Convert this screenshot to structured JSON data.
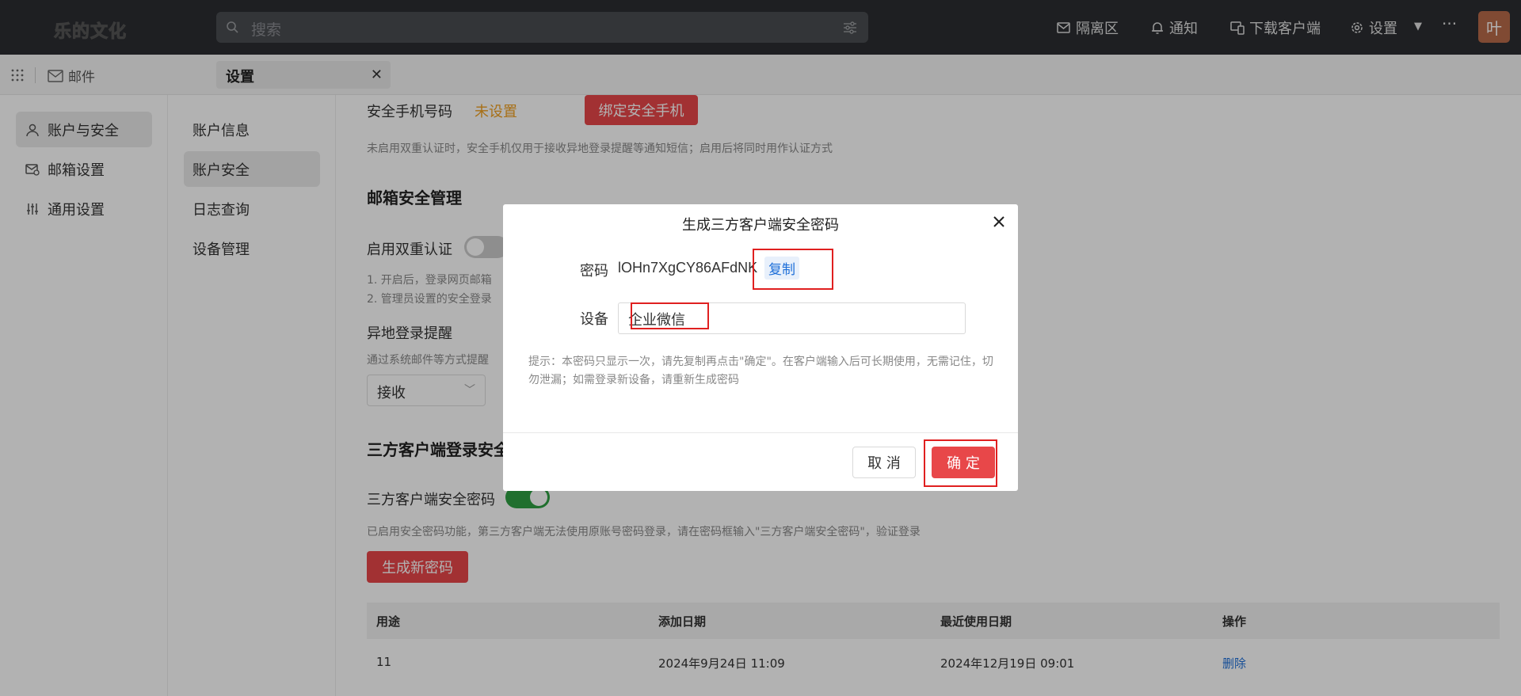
{
  "topbar": {
    "logo": "乐的文化",
    "search_placeholder": "搜索",
    "quarantine": "隔离区",
    "notify": "通知",
    "download": "下载客户端",
    "settings": "设置",
    "more": "···",
    "avatar": "叶"
  },
  "tabs": {
    "mail": "邮件",
    "settings": "设置"
  },
  "sidebar": {
    "items": [
      {
        "label": "账户与安全"
      },
      {
        "label": "邮箱设置"
      },
      {
        "label": "通用设置"
      }
    ]
  },
  "subnav": {
    "items": [
      {
        "label": "账户信息"
      },
      {
        "label": "账户安全"
      },
      {
        "label": "日志查询"
      },
      {
        "label": "设备管理"
      }
    ]
  },
  "main": {
    "phone_label": "安全手机号码",
    "phone_value": "未设置",
    "bind_phone_btn": "绑定安全手机",
    "phone_hint": "未启用双重认证时，安全手机仅用于接收异地登录提醒等通知短信；启用后将同时用作认证方式",
    "mailbox_security_title": "邮箱安全管理",
    "twofa_label": "启用双重认证",
    "twofa_hint1": "1. 开启后，登录网页邮箱",
    "twofa_hint2": "2. 管理员设置的安全登录",
    "remote_login_label": "异地登录提醒",
    "remote_login_hint": "通过系统邮件等方式提醒",
    "remote_login_select": "接收",
    "third_party_title": "三方客户端登录安全",
    "third_party_pwd_label": "三方客户端安全密码",
    "third_party_hint": "已启用安全密码功能，第三方客户端无法使用原账号密码登录，请在密码框输入\"三方客户端安全密码\"，验证登录",
    "gen_pwd_btn": "生成新密码",
    "table": {
      "headers": [
        "用途",
        "添加日期",
        "最近使用日期",
        "操作"
      ],
      "rows": [
        {
          "purpose": "11",
          "added": "2024年9月24日 11:09",
          "last_used": "2024年12月19日 09:01",
          "action": "删除"
        }
      ]
    }
  },
  "dialog": {
    "title": "生成三方客户端安全密码",
    "pwd_label": "密码",
    "pwd_value": "lOHn7XgCY86AFdNK",
    "copy": "复制",
    "device_label": "设备",
    "device_value": "企业微信",
    "hint": "提示：本密码只显示一次，请先复制再点击\"确定\"。在客户端输入后可长期使用，无需记住，切勿泄漏；如需登录新设备，请重新生成密码",
    "cancel": "取 消",
    "ok": "确 定"
  },
  "colors": {
    "accent_red": "#e84749",
    "warn_orange": "#f0a020",
    "toggle_on": "#2ea043",
    "link_blue": "#1e6fd9"
  }
}
